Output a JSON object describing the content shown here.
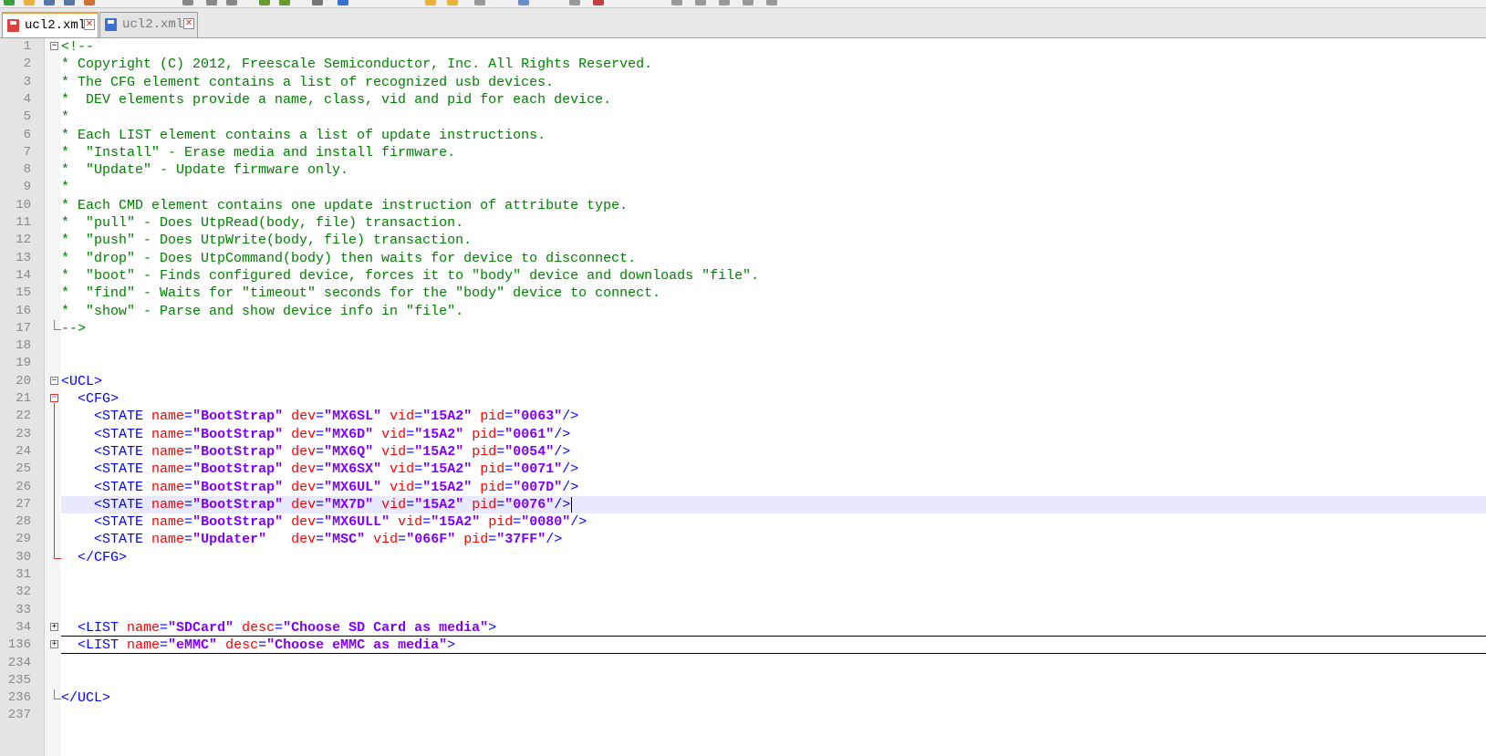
{
  "toolbar": {
    "icons": [
      "toolbar-icons"
    ]
  },
  "tabs": [
    {
      "label": "ucl2.xml",
      "active": true,
      "icon": "file-modified-icon",
      "icon_color": "#e04040"
    },
    {
      "label": "ucl2.xml",
      "active": false,
      "icon": "file-saved-icon",
      "icon_color": "#3b6fd0"
    }
  ],
  "colors": {
    "comment": "#008000",
    "tag": "#0000ff",
    "attribute": "#ff0000",
    "value": "#8000ff",
    "current_line": "#e8e8ff",
    "active_tab_accent": "#f39c37"
  },
  "editor": {
    "lines": [
      {
        "num": "1",
        "fold": "minus",
        "tokens": [
          [
            "c",
            "<!--"
          ]
        ]
      },
      {
        "num": "2",
        "tokens": [
          [
            "c",
            "* Copyright (C) 2012, Freescale Semiconductor, Inc. All Rights Reserved."
          ]
        ]
      },
      {
        "num": "3",
        "tokens": [
          [
            "c",
            "* The CFG element contains a list of recognized usb devices."
          ]
        ]
      },
      {
        "num": "4",
        "tokens": [
          [
            "c",
            "*  DEV elements provide a name, class, vid and pid for each device."
          ]
        ]
      },
      {
        "num": "5",
        "tokens": [
          [
            "c",
            "*"
          ]
        ]
      },
      {
        "num": "6",
        "tokens": [
          [
            "c",
            "* Each LIST element contains a list of update instructions."
          ]
        ]
      },
      {
        "num": "7",
        "tokens": [
          [
            "c",
            "*  \"Install\" - Erase media and install firmware."
          ]
        ]
      },
      {
        "num": "8",
        "tokens": [
          [
            "c",
            "*  \"Update\" - Update firmware only."
          ]
        ]
      },
      {
        "num": "9",
        "tokens": [
          [
            "c",
            "*"
          ]
        ]
      },
      {
        "num": "10",
        "tokens": [
          [
            "c",
            "* Each CMD element contains one update instruction of attribute type."
          ]
        ]
      },
      {
        "num": "11",
        "tokens": [
          [
            "c",
            "*  \"pull\" - Does UtpRead(body, file) transaction."
          ]
        ]
      },
      {
        "num": "12",
        "tokens": [
          [
            "c",
            "*  \"push\" - Does UtpWrite(body, file) transaction."
          ]
        ]
      },
      {
        "num": "13",
        "tokens": [
          [
            "c",
            "*  \"drop\" - Does UtpCommand(body) then waits for device to disconnect."
          ]
        ]
      },
      {
        "num": "14",
        "tokens": [
          [
            "c",
            "*  \"boot\" - Finds configured device, forces it to \"body\" device and downloads \"file\"."
          ]
        ]
      },
      {
        "num": "15",
        "tokens": [
          [
            "c",
            "*  \"find\" - Waits for \"timeout\" seconds for the \"body\" device to connect."
          ]
        ]
      },
      {
        "num": "16",
        "tokens": [
          [
            "c",
            "*  \"show\" - Parse and show device info in \"file\"."
          ]
        ]
      },
      {
        "num": "17",
        "fold": "end",
        "tokens": [
          [
            "c",
            "-->"
          ]
        ]
      },
      {
        "num": "18",
        "tokens": []
      },
      {
        "num": "19",
        "tokens": []
      },
      {
        "num": "20",
        "fold": "minus",
        "tokens": [
          [
            "t",
            "<UCL>"
          ]
        ]
      },
      {
        "num": "21",
        "fold": "minus-red",
        "tokens": [
          [
            "t",
            "  <CFG>"
          ]
        ]
      },
      {
        "num": "22",
        "tokens": [
          [
            "t",
            "    <STATE "
          ],
          [
            "a",
            "name"
          ],
          [
            "t",
            "="
          ],
          [
            "s",
            "\"BootStrap\""
          ],
          [
            "t",
            " "
          ],
          [
            "a",
            "dev"
          ],
          [
            "t",
            "="
          ],
          [
            "s",
            "\"MX6SL\""
          ],
          [
            "t",
            " "
          ],
          [
            "a",
            "vid"
          ],
          [
            "t",
            "="
          ],
          [
            "s",
            "\"15A2\""
          ],
          [
            "t",
            " "
          ],
          [
            "a",
            "pid"
          ],
          [
            "t",
            "="
          ],
          [
            "s",
            "\"0063\""
          ],
          [
            "t",
            "/>"
          ]
        ]
      },
      {
        "num": "23",
        "tokens": [
          [
            "t",
            "    <STATE "
          ],
          [
            "a",
            "name"
          ],
          [
            "t",
            "="
          ],
          [
            "s",
            "\"BootStrap\""
          ],
          [
            "t",
            " "
          ],
          [
            "a",
            "dev"
          ],
          [
            "t",
            "="
          ],
          [
            "s",
            "\"MX6D\""
          ],
          [
            "t",
            " "
          ],
          [
            "a",
            "vid"
          ],
          [
            "t",
            "="
          ],
          [
            "s",
            "\"15A2\""
          ],
          [
            "t",
            " "
          ],
          [
            "a",
            "pid"
          ],
          [
            "t",
            "="
          ],
          [
            "s",
            "\"0061\""
          ],
          [
            "t",
            "/>"
          ]
        ]
      },
      {
        "num": "24",
        "tokens": [
          [
            "t",
            "    <STATE "
          ],
          [
            "a",
            "name"
          ],
          [
            "t",
            "="
          ],
          [
            "s",
            "\"BootStrap\""
          ],
          [
            "t",
            " "
          ],
          [
            "a",
            "dev"
          ],
          [
            "t",
            "="
          ],
          [
            "s",
            "\"MX6Q\""
          ],
          [
            "t",
            " "
          ],
          [
            "a",
            "vid"
          ],
          [
            "t",
            "="
          ],
          [
            "s",
            "\"15A2\""
          ],
          [
            "t",
            " "
          ],
          [
            "a",
            "pid"
          ],
          [
            "t",
            "="
          ],
          [
            "s",
            "\"0054\""
          ],
          [
            "t",
            "/>"
          ]
        ]
      },
      {
        "num": "25",
        "tokens": [
          [
            "t",
            "    <STATE "
          ],
          [
            "a",
            "name"
          ],
          [
            "t",
            "="
          ],
          [
            "s",
            "\"BootStrap\""
          ],
          [
            "t",
            " "
          ],
          [
            "a",
            "dev"
          ],
          [
            "t",
            "="
          ],
          [
            "s",
            "\"MX6SX\""
          ],
          [
            "t",
            " "
          ],
          [
            "a",
            "vid"
          ],
          [
            "t",
            "="
          ],
          [
            "s",
            "\"15A2\""
          ],
          [
            "t",
            " "
          ],
          [
            "a",
            "pid"
          ],
          [
            "t",
            "="
          ],
          [
            "s",
            "\"0071\""
          ],
          [
            "t",
            "/>"
          ]
        ]
      },
      {
        "num": "26",
        "tokens": [
          [
            "t",
            "    <STATE "
          ],
          [
            "a",
            "name"
          ],
          [
            "t",
            "="
          ],
          [
            "s",
            "\"BootStrap\""
          ],
          [
            "t",
            " "
          ],
          [
            "a",
            "dev"
          ],
          [
            "t",
            "="
          ],
          [
            "s",
            "\"MX6UL\""
          ],
          [
            "t",
            " "
          ],
          [
            "a",
            "vid"
          ],
          [
            "t",
            "="
          ],
          [
            "s",
            "\"15A2\""
          ],
          [
            "t",
            " "
          ],
          [
            "a",
            "pid"
          ],
          [
            "t",
            "="
          ],
          [
            "s",
            "\"007D\""
          ],
          [
            "t",
            "/>"
          ]
        ]
      },
      {
        "num": "27",
        "current": true,
        "tokens": [
          [
            "t",
            "    <STATE "
          ],
          [
            "a",
            "name"
          ],
          [
            "t",
            "="
          ],
          [
            "s",
            "\"BootStrap\""
          ],
          [
            "t",
            " "
          ],
          [
            "a",
            "dev"
          ],
          [
            "t",
            "="
          ],
          [
            "s",
            "\"MX7D\""
          ],
          [
            "t",
            " "
          ],
          [
            "a",
            "vid"
          ],
          [
            "t",
            "="
          ],
          [
            "s",
            "\"15A2\""
          ],
          [
            "t",
            " "
          ],
          [
            "a",
            "pid"
          ],
          [
            "t",
            "="
          ],
          [
            "s",
            "\"0076\""
          ],
          [
            "t",
            "/>"
          ]
        ]
      },
      {
        "num": "28",
        "tokens": [
          [
            "t",
            "    <STATE "
          ],
          [
            "a",
            "name"
          ],
          [
            "t",
            "="
          ],
          [
            "s",
            "\"BootStrap\""
          ],
          [
            "t",
            " "
          ],
          [
            "a",
            "dev"
          ],
          [
            "t",
            "="
          ],
          [
            "s",
            "\"MX6ULL\""
          ],
          [
            "t",
            " "
          ],
          [
            "a",
            "vid"
          ],
          [
            "t",
            "="
          ],
          [
            "s",
            "\"15A2\""
          ],
          [
            "t",
            " "
          ],
          [
            "a",
            "pid"
          ],
          [
            "t",
            "="
          ],
          [
            "s",
            "\"0080\""
          ],
          [
            "t",
            "/>"
          ]
        ]
      },
      {
        "num": "29",
        "tokens": [
          [
            "t",
            "    <STATE "
          ],
          [
            "a",
            "name"
          ],
          [
            "t",
            "="
          ],
          [
            "s",
            "\"Updater\""
          ],
          [
            "t",
            "   "
          ],
          [
            "a",
            "dev"
          ],
          [
            "t",
            "="
          ],
          [
            "s",
            "\"MSC\""
          ],
          [
            "t",
            " "
          ],
          [
            "a",
            "vid"
          ],
          [
            "t",
            "="
          ],
          [
            "s",
            "\"066F\""
          ],
          [
            "t",
            " "
          ],
          [
            "a",
            "pid"
          ],
          [
            "t",
            "="
          ],
          [
            "s",
            "\"37FF\""
          ],
          [
            "t",
            "/>"
          ]
        ]
      },
      {
        "num": "30",
        "fold": "end-red",
        "tokens": [
          [
            "t",
            "  </CFG>"
          ]
        ]
      },
      {
        "num": "31",
        "tokens": []
      },
      {
        "num": "32",
        "tokens": []
      },
      {
        "num": "33",
        "tokens": []
      },
      {
        "num": "34",
        "fold": "plus",
        "folded": true,
        "tokens": [
          [
            "t",
            "  <LIST "
          ],
          [
            "a",
            "name"
          ],
          [
            "t",
            "="
          ],
          [
            "s",
            "\"SDCard\""
          ],
          [
            "t",
            " "
          ],
          [
            "a",
            "desc"
          ],
          [
            "t",
            "="
          ],
          [
            "s",
            "\"Choose SD Card as media\""
          ],
          [
            "t",
            ">"
          ]
        ]
      },
      {
        "num": "136",
        "fold": "plus",
        "folded": true,
        "tokens": [
          [
            "t",
            "  <LIST "
          ],
          [
            "a",
            "name"
          ],
          [
            "t",
            "="
          ],
          [
            "s",
            "\"eMMC\""
          ],
          [
            "t",
            " "
          ],
          [
            "a",
            "desc"
          ],
          [
            "t",
            "="
          ],
          [
            "s",
            "\"Choose eMMC as media\""
          ],
          [
            "t",
            ">"
          ]
        ]
      },
      {
        "num": "234",
        "tokens": []
      },
      {
        "num": "235",
        "tokens": []
      },
      {
        "num": "236",
        "fold": "end",
        "tokens": [
          [
            "t",
            "</UCL>"
          ]
        ]
      },
      {
        "num": "237",
        "tokens": []
      }
    ]
  }
}
